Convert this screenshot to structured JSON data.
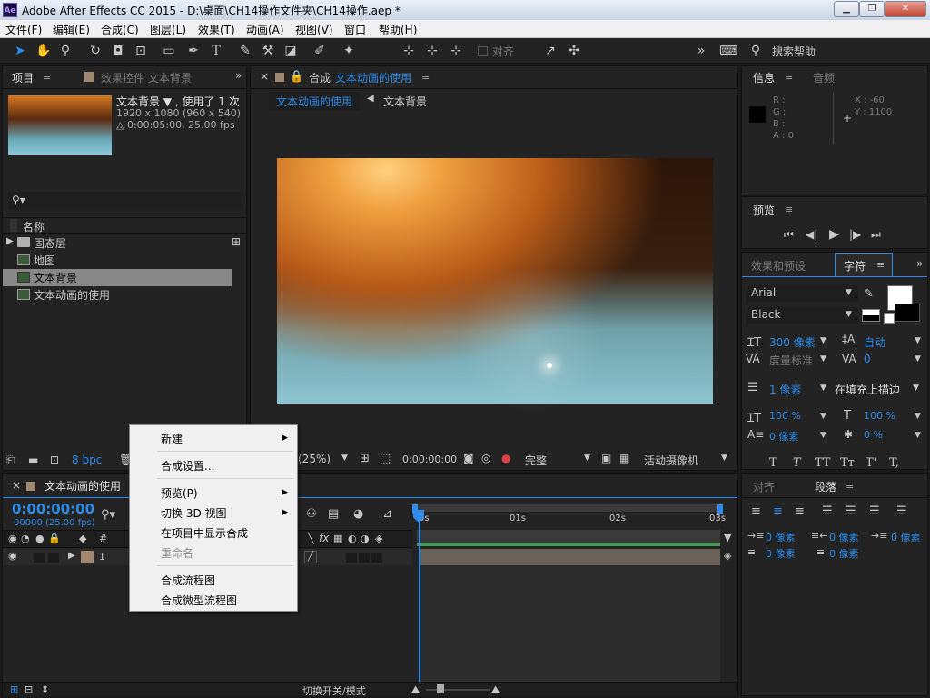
{
  "titlebar": {
    "logo": "Ae",
    "title": "Adobe After Effects CC 2015 - D:\\桌面\\CH14操作文件夹\\CH14操作.aep *",
    "min": "▁",
    "max": "❐",
    "close": "✕"
  },
  "menubar": {
    "items": [
      "文件(F)",
      "编辑(E)",
      "合成(C)",
      "图层(L)",
      "效果(T)",
      "动画(A)",
      "视图(V)",
      "窗口",
      "帮助(H)"
    ]
  },
  "toolbar": {
    "align_label": "对齐",
    "search_label": "搜索帮助"
  },
  "project": {
    "tab_project": "项目",
    "tab_effects": "效果控件 文本背景",
    "selected_name": "文本背景 ▼ , 使用了 1 次",
    "dims": "1920 x 1080  (960 x 540) ...",
    "duration": "△ 0:00:05:00, 25.00 fps",
    "col_name": "名称",
    "items": [
      "固态层",
      "地图",
      "文本背景",
      "文本动画的使用"
    ],
    "bpc": "8 bpc"
  },
  "comp": {
    "tab_prefix": "合成",
    "tab_name": "文本动画的使用",
    "crumb1": "文本动画的使用",
    "crumb2": "文本背景",
    "zoom": "(25%)",
    "timecode": "0:00:00:00",
    "quality": "完整",
    "camera": "活动摄像机"
  },
  "info": {
    "tab_info": "信息",
    "tab_audio": "音频",
    "r": "R :",
    "g": "G :",
    "b": "B :",
    "a": "A : 0",
    "x": "X : -60",
    "y": "Y : 1100"
  },
  "preview": {
    "title": "预览"
  },
  "character": {
    "tab_effects": "效果和预设",
    "tab_char": "字符",
    "font": "Arial",
    "style": "Black",
    "size": "300 像素",
    "leading": "自动",
    "kerning": "度量标准",
    "tracking": "0",
    "stroke": "1 像素",
    "stroke_mode": "在填充上描边",
    "vscale": "100 %",
    "hscale": "100 %",
    "baseline": "0 像素",
    "tsume": "0 %",
    "styles": [
      "T",
      "T",
      "TT",
      "Tт",
      "T'",
      "T,"
    ]
  },
  "paragraph": {
    "tab_align": "对齐",
    "tab_para": "段落",
    "indent_left": "0 像素",
    "indent_right": "0 像素",
    "indent_first": "0 像素",
    "space_before": "0 像素",
    "space_after": "0 像素"
  },
  "timeline": {
    "tab_name": "文本动画的使用",
    "timecode": "0:00:00:00",
    "fps": "00000 (25.00 fps)",
    "ruler": [
      "0s",
      "01s",
      "02s",
      "03s"
    ],
    "layer_num": "1",
    "toggle_label": "切换开关/模式"
  },
  "context_menu": {
    "items": [
      "新建",
      "合成设置...",
      "预览(P)",
      "切换 3D 视图",
      "在项目中显示合成",
      "重命名",
      "合成流程图",
      "合成微型流程图"
    ]
  },
  "colors": {
    "accent": "#2d8ceb",
    "panel": "#232323",
    "selection": "#888888"
  }
}
